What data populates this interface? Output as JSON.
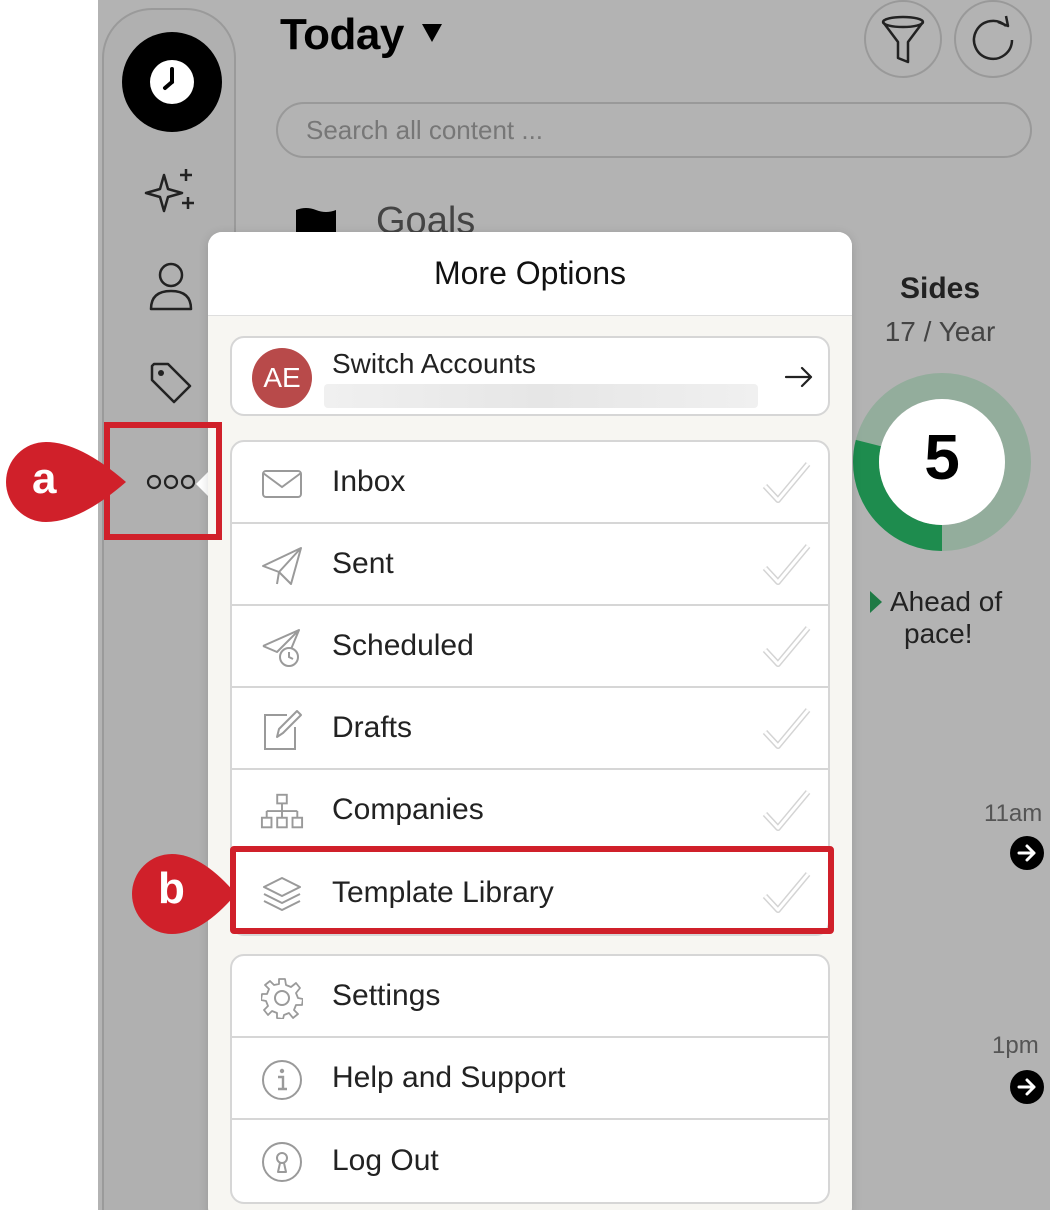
{
  "header": {
    "title": "Today",
    "search_placeholder": "Search all content ..."
  },
  "goals": {
    "label": "Goals"
  },
  "stats": {
    "title": "Sides",
    "subtitle": "17 / Year",
    "count": "5",
    "progress_fraction": 0.29,
    "pace_line1": "Ahead of",
    "pace_line2": "pace!",
    "accent_color": "#1e8c4e"
  },
  "timeline": {
    "times": [
      "11am",
      "1pm"
    ]
  },
  "menu": {
    "title": "More Options",
    "account": {
      "initials": "AE",
      "label": "Switch Accounts"
    },
    "items": [
      {
        "label": "Inbox",
        "icon": "envelope-icon"
      },
      {
        "label": "Sent",
        "icon": "paper-plane-icon"
      },
      {
        "label": "Scheduled",
        "icon": "scheduled-plane-icon"
      },
      {
        "label": "Drafts",
        "icon": "edit-icon"
      },
      {
        "label": "Companies",
        "icon": "org-chart-icon"
      },
      {
        "label": "Template Library",
        "icon": "layers-icon"
      }
    ],
    "footer_items": [
      {
        "label": "Settings",
        "icon": "gear-icon"
      },
      {
        "label": "Help and Support",
        "icon": "info-icon"
      },
      {
        "label": "Log Out",
        "icon": "keyhole-icon"
      }
    ]
  },
  "annotations": {
    "a": "a",
    "b": "b",
    "color": "#d0202a"
  }
}
